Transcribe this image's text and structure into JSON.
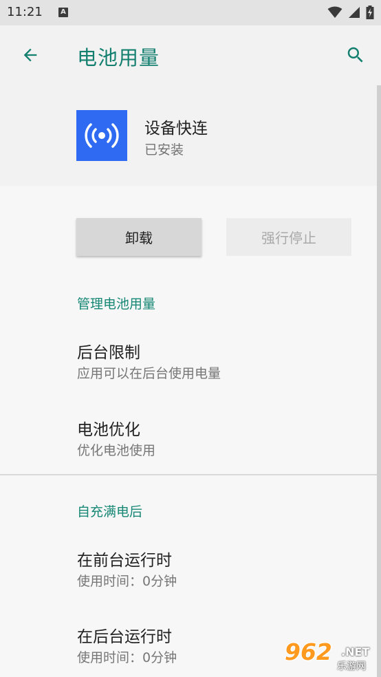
{
  "status_bar": {
    "time": "11:21",
    "notification_badge": "A"
  },
  "app_bar": {
    "title": "电池用量",
    "back_icon": "arrow-back-icon",
    "search_icon": "search-icon"
  },
  "app_info": {
    "name": "设备快连",
    "status": "已安装",
    "icon": "broadcast-icon",
    "icon_color": "#2e6af2"
  },
  "actions": {
    "uninstall_label": "卸载",
    "force_stop_label": "强行停止"
  },
  "sections": {
    "manage": {
      "header": "管理电池用量",
      "items": [
        {
          "title": "后台限制",
          "summary": "应用可以在后台使用电量"
        },
        {
          "title": "电池优化",
          "summary": "优化电池使用"
        }
      ]
    },
    "since_full_charge": {
      "header": "自充满电后",
      "items": [
        {
          "title": "在前台运行时",
          "summary": "使用时间：0分钟"
        },
        {
          "title": "在后台运行时",
          "summary": "使用时间：0分钟"
        }
      ]
    }
  },
  "watermark": {
    "main": "962",
    "net": ".NET",
    "sub": "乐游网"
  },
  "colors": {
    "accent": "#137f6f",
    "status_bar_bg": "#e3e3e3"
  }
}
